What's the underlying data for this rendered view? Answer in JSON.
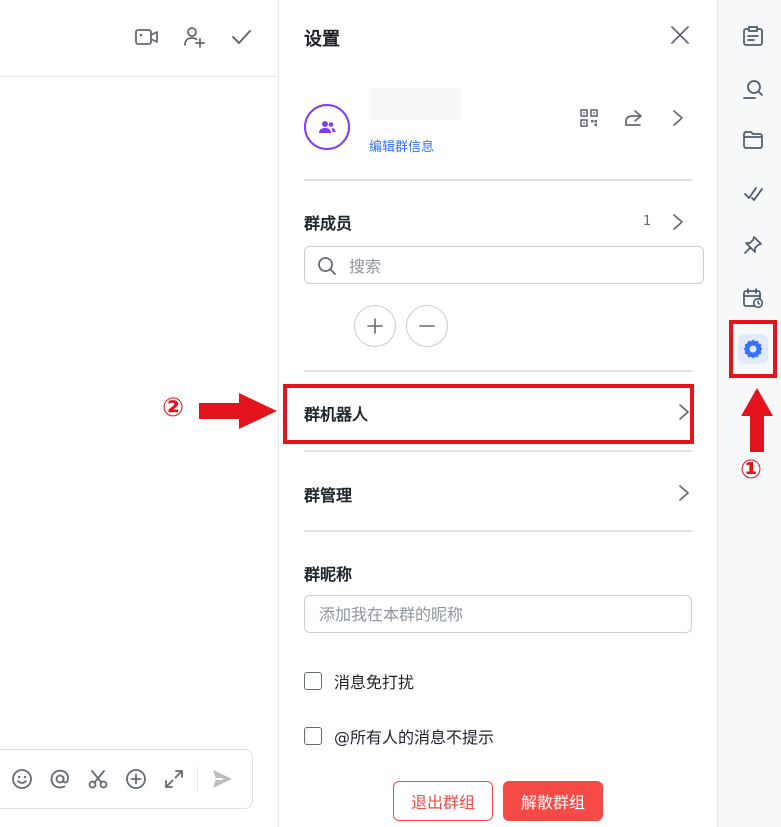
{
  "chat": {
    "header_icons": [
      "video-call-icon",
      "add-member-icon",
      "checkmark-icon"
    ],
    "toolbar_icons": [
      "emoji-icon",
      "mention-icon",
      "screenshot-icon",
      "add-icon",
      "expand-icon",
      "send-icon"
    ]
  },
  "settings": {
    "title": "设置",
    "edit_group_info": "编辑群信息",
    "members": {
      "title": "群成员",
      "count": "1",
      "search_placeholder": "搜索"
    },
    "rows": {
      "group_bots": "群机器人",
      "group_management": "群管理"
    },
    "nickname": {
      "title": "群昵称",
      "placeholder": "添加我在本群的昵称"
    },
    "checkboxes": {
      "mute": "消息免打扰",
      "at_all": "@所有人的消息不提示"
    },
    "buttons": {
      "leave": "退出群组",
      "dissolve": "解散群组"
    }
  },
  "sidebar": {
    "icons": [
      "announcement-icon",
      "search-history-icon",
      "folder-icon",
      "tasks-icon",
      "pin-icon",
      "calendar-icon",
      "settings-icon"
    ],
    "active": "settings-icon"
  },
  "annotations": {
    "step1": "①",
    "step2": "②",
    "color": "#e3141c"
  },
  "colors": {
    "accent": "#3370ff",
    "danger": "#f54a45",
    "avatar_ring": "#7f3bf5"
  }
}
